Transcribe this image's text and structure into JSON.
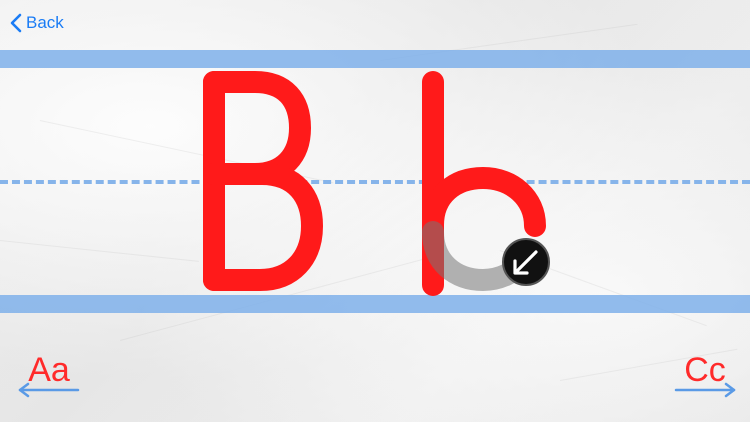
{
  "navigation": {
    "back_label": "Back",
    "prev_letter": "Aa",
    "next_letter": "Cc"
  },
  "tracing": {
    "uppercase": "B",
    "lowercase": "b",
    "letter_color": "#ff1a1a",
    "guide_color": "#7fb0ea",
    "stroke_hint_icon": "arrow-down-left-icon"
  },
  "colors": {
    "accent": "#1a7cf5",
    "letter": "#ff1a1a",
    "guide_lines": "#7fb0ea",
    "trace_shadow": "#7a7a7a"
  }
}
